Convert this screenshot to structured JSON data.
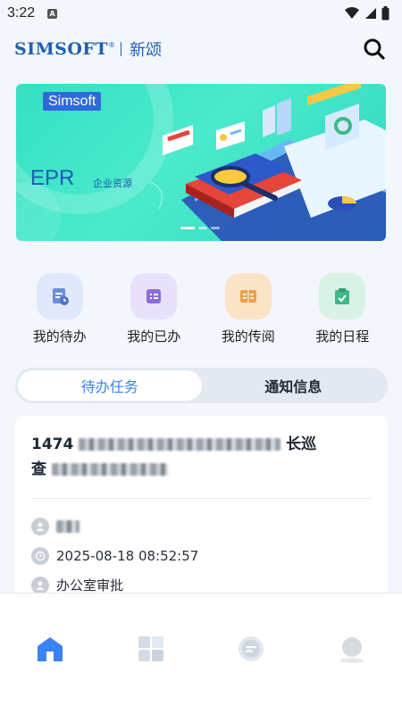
{
  "status_bar": {
    "time": "3:22",
    "app_indicator": "A"
  },
  "header": {
    "logo_text": "SIMSOFT",
    "logo_mark": "®",
    "logo_cn": "新颂",
    "search_icon": "search-icon"
  },
  "banner": {
    "brand": "Simsoft",
    "title": "EPR",
    "subtitle": "企业资源",
    "active_slide": 1,
    "slide_count": 3
  },
  "quick_actions": [
    {
      "label": "我的待办",
      "icon": "todo-icon",
      "bg": "#dfe9fb",
      "fg": "#6b8fd6"
    },
    {
      "label": "我的已办",
      "icon": "done-list-icon",
      "bg": "#e8e1fb",
      "fg": "#8b6fd8"
    },
    {
      "label": "我的传阅",
      "icon": "book-icon",
      "bg": "#fbe3c5",
      "fg": "#e9a24c"
    },
    {
      "label": "我的日程",
      "icon": "calendar-check-icon",
      "bg": "#d9f2e6",
      "fg": "#3fb888"
    }
  ],
  "tabs": [
    {
      "label": "待办任务",
      "active": true
    },
    {
      "label": "通知信息",
      "active": false
    }
  ],
  "task": {
    "id": "1474",
    "title_tail": "长巡",
    "title_line2_start": "查",
    "datetime": "2025-08-18 08:52:57",
    "department": "办公室审批"
  },
  "bottom_nav": [
    {
      "icon": "home-icon",
      "active": true
    },
    {
      "icon": "apps-grid-icon",
      "active": false
    },
    {
      "icon": "message-icon",
      "active": false
    },
    {
      "icon": "profile-icon",
      "active": false
    }
  ],
  "colors": {
    "accent": "#3b82f6",
    "brand": "#1e5fb3",
    "banner": "#3fe4c6"
  }
}
